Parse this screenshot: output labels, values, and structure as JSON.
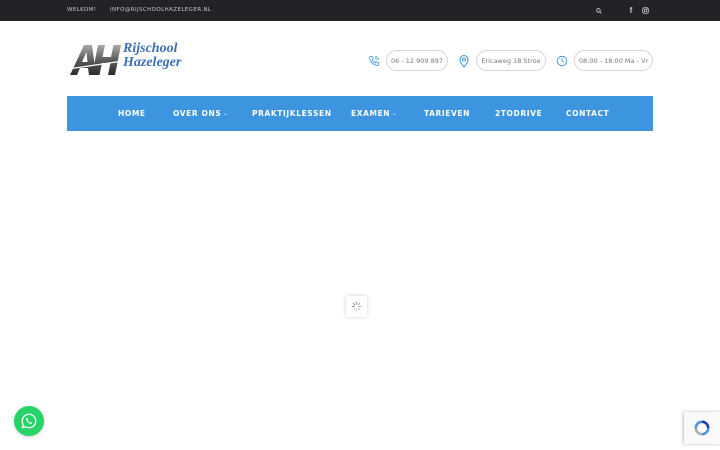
{
  "topbar": {
    "welcome": "WELKOM!",
    "email": "INFO@RIJSCHOOLHAZELEGER.NL",
    "icons": [
      "search-icon",
      "facebook-icon",
      "instagram-icon"
    ]
  },
  "logo": {
    "line1": "Rijschool",
    "line2": "Hazeleger"
  },
  "contact": {
    "phone": "06 - 12 909 897",
    "address": "Ericaweg 18 Stroe",
    "hours": "08:00 - 18:00 Ma - Vr"
  },
  "nav": {
    "items": [
      {
        "label": "HOME"
      },
      {
        "label": "OVER ONS",
        "caret": "⌄"
      },
      {
        "label": "PRAKTIJKLESSEN"
      },
      {
        "label": "EXAMEN",
        "caret": "⌄"
      },
      {
        "label": "TARIEVEN"
      },
      {
        "label": "2TODRIVE"
      },
      {
        "label": "CONTACT"
      }
    ]
  },
  "colors": {
    "topbar": "#222327",
    "nav": "#3d95e0",
    "accent": "#3a6fb4",
    "whatsapp": "#25d366"
  }
}
